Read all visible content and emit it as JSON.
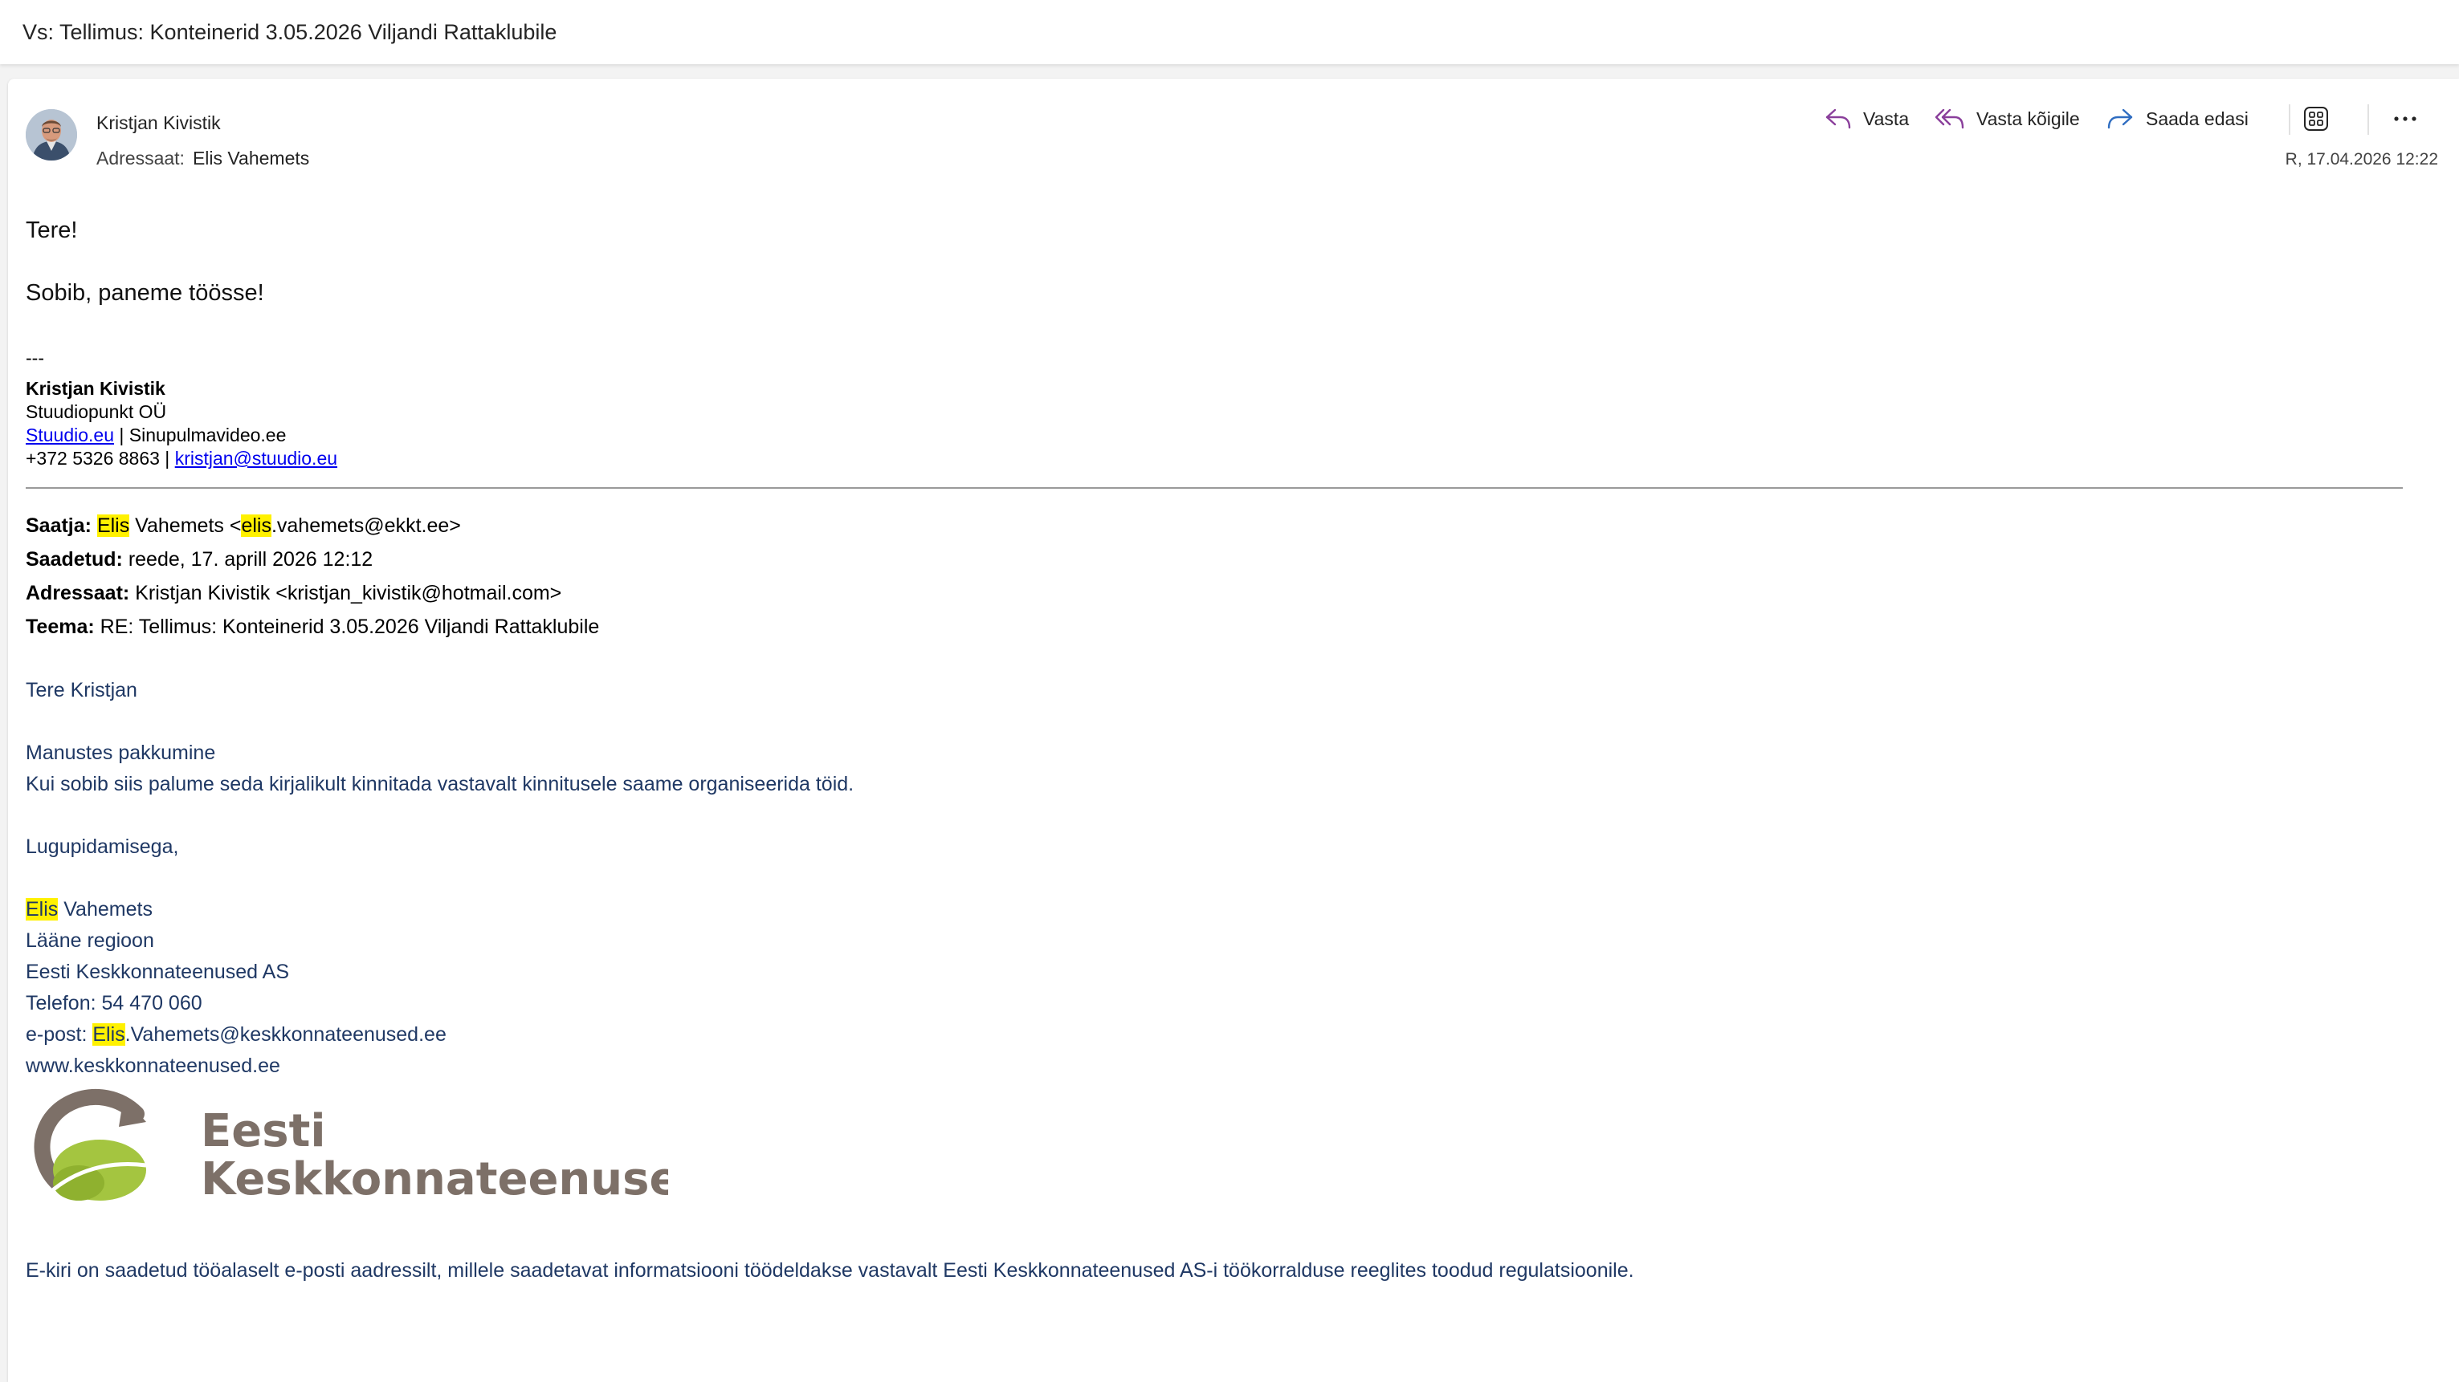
{
  "subject": "Vs: Tellimus: Konteinerid 3.05.2026 Viljandi Rattaklubile",
  "header": {
    "sender_name": "Kristjan Kivistik",
    "recipient_label": "Adressaat:",
    "recipient_name": "Elis Vahemets",
    "date": "R, 17.04.2026 12:22"
  },
  "actions": {
    "reply": "Vasta",
    "reply_all": "Vasta kõigile",
    "forward": "Saada edasi"
  },
  "colors": {
    "accent_purple": "#8a3f9b",
    "accent_blue": "#2f6dc1",
    "body_blue": "#1f3864",
    "highlight": "#fff100",
    "logo_gray": "#7d7068",
    "logo_green": "#a4c540"
  },
  "icons": {
    "reply": "reply-icon",
    "reply_all": "reply-all-icon",
    "forward": "forward-icon",
    "apps": "apps-icon",
    "more": "more-icon"
  },
  "body": {
    "greeting": "Tere!",
    "message": "Sobib, paneme töösse!",
    "sig_dash": "---",
    "sig_name": "Kristjan Kivistik",
    "sig_company": "Stuudiopunkt OÜ",
    "sig_link1": "Stuudio.eu",
    "sig_sep1": " | ",
    "sig_site2": "Sinupulmavideo.ee",
    "sig_phone": "+372 5326 8863",
    "sig_sep2": " | ",
    "sig_email": "kristjan@stuudio.eu"
  },
  "quoted_header": {
    "from_label": "Saatja:",
    "from_hl1": "Elis",
    "from_mid": " Vahemets <",
    "from_hl2": "elis",
    "from_rest": ".vahemets@ekkt.ee>",
    "sent_label": "Saadetud:",
    "sent_value": "reede, 17. aprill 2026 12:12",
    "to_label": "Adressaat:",
    "to_value": "Kristjan Kivistik <kristjan_kivistik@hotmail.com>",
    "subject_label": "Teema:",
    "subject_value": "RE: Tellimus: Konteinerid 3.05.2026 Viljandi Rattaklubile"
  },
  "quoted_body": {
    "greeting": "Tere Kristjan",
    "line1": "Manustes pakkumine",
    "line2": "Kui sobib siis palume seda kirjalikult kinnitada vastavalt kinnitusele saame organiseerida töid.",
    "closing": "Lugupidamisega,",
    "sig_first_hl": "Elis",
    "sig_last": " Vahemets",
    "region": "Lääne regioon",
    "company": "Eesti Keskkonnateenused AS",
    "phone": "Telefon: 54 470 060",
    "email_prefix": "e-post: ",
    "email_hl": "Elis",
    "email_rest": ".Vahemets@keskkonnateenused.ee",
    "website": "www.keskkonnateenused.ee",
    "logo_line1": "Eesti",
    "logo_line2": "Keskkonnateenused",
    "disclaimer": "E-kiri on saadetud tööalaselt e-posti aadressilt, millele saadetavat informatsiooni töödeldakse vastavalt Eesti Keskkonnateenused AS-i töökorralduse reeglites toodud regulatsioonile."
  }
}
